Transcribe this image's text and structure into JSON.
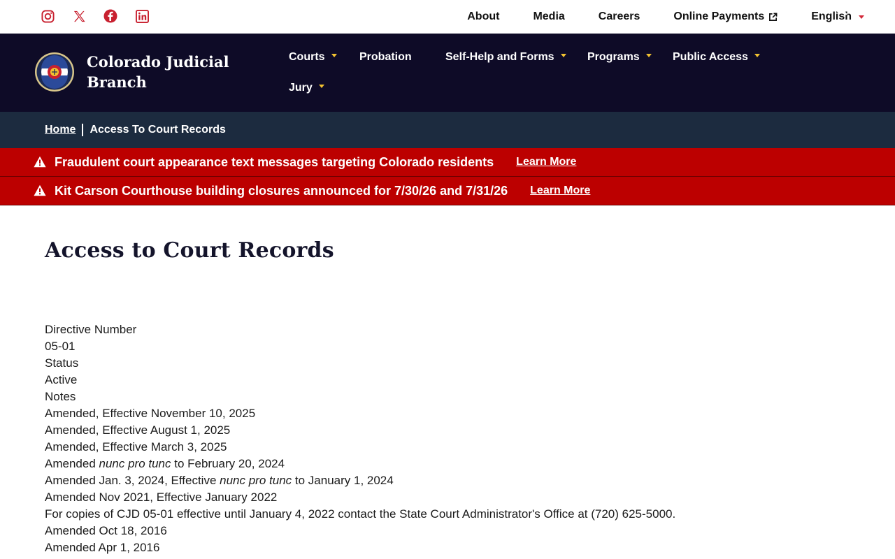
{
  "utility": {
    "social": [
      {
        "name": "instagram",
        "icon": "instagram-icon"
      },
      {
        "name": "x",
        "icon": "x-icon"
      },
      {
        "name": "facebook",
        "icon": "facebook-icon"
      },
      {
        "name": "linkedin",
        "icon": "linkedin-icon"
      }
    ],
    "links": {
      "about": "About",
      "media": "Media",
      "careers": "Careers",
      "payments": "Online Payments",
      "language": "English"
    }
  },
  "brand": {
    "line1": "Colorado Judicial",
    "line2": "Branch",
    "seal_icon": "colorado-courts-seal"
  },
  "nav": {
    "courts": "Courts",
    "probation": "Probation",
    "self_help": "Self-Help and Forms",
    "programs": "Programs",
    "public_access": "Public Access",
    "jury": "Jury"
  },
  "breadcrumb": {
    "home": "Home",
    "current": "Access To Court Records"
  },
  "alerts": [
    {
      "message": "Fraudulent court appearance text messages targeting Colorado residents",
      "link": "Learn More"
    },
    {
      "message": "Kit Carson Courthouse building closures announced for 7/30/26 and 7/31/26",
      "link": "Learn More"
    }
  ],
  "page": {
    "title": "Access to Court Records",
    "directive_label": "Directive Number",
    "directive_value": "05-01",
    "status_label": "Status",
    "status_value": "Active",
    "notes_label": "Notes",
    "notes": {
      "n1": "Amended, Effective November 10, 2025",
      "n2": "Amended, Effective August 1, 2025",
      "n3": "Amended, Effective March 3, 2025",
      "n4_pre": "Amended ",
      "n4_em": "nunc pro tunc",
      "n4_post": " to February 20, 2024",
      "n5_pre": "Amended Jan. 3, 2024, Effective ",
      "n5_em": "nunc pro tunc",
      "n5_post": " to January 1, 2024",
      "n6": "Amended Nov 2021, Effective January 2022",
      "n7": "For copies of CJD 05-01 effective until January 4, 2022 contact the State Court Administrator's Office at (720) 625-5000.",
      "n8": "Amended Oct 18, 2016",
      "n9": "Amended Apr 1, 2016"
    }
  },
  "colors": {
    "nav_bg": "#0e0b27",
    "breadcrumb_bg": "#1c2b3f",
    "alert_bg": "#bc0000",
    "accent_gold": "#f2c230",
    "social_red": "#c8202f"
  }
}
